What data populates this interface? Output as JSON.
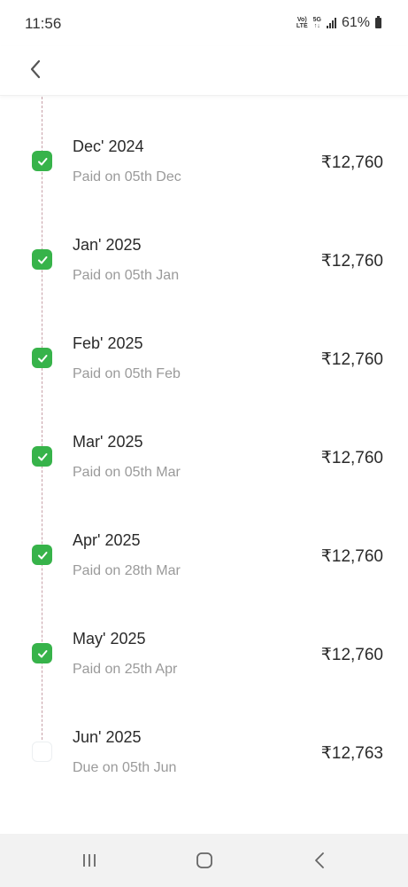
{
  "status": {
    "time": "11:56",
    "battery": "61%",
    "volte_top": "Vo)",
    "volte_bottom": "LTE",
    "net_top": "5G",
    "net_bottom": "↑↓"
  },
  "payments": [
    {
      "month": "Dec' 2024",
      "status_text": "Paid on 05th Dec",
      "amount": "₹12,760",
      "paid": true
    },
    {
      "month": "Jan' 2025",
      "status_text": "Paid on 05th Jan",
      "amount": "₹12,760",
      "paid": true
    },
    {
      "month": "Feb' 2025",
      "status_text": "Paid on 05th Feb",
      "amount": "₹12,760",
      "paid": true
    },
    {
      "month": "Mar' 2025",
      "status_text": "Paid on 05th Mar",
      "amount": "₹12,760",
      "paid": true
    },
    {
      "month": "Apr' 2025",
      "status_text": "Paid on 28th Mar",
      "amount": "₹12,760",
      "paid": true
    },
    {
      "month": "May' 2025",
      "status_text": "Paid on 25th Apr",
      "amount": "₹12,760",
      "paid": true
    },
    {
      "month": "Jun' 2025",
      "status_text": "Due on 05th Jun",
      "amount": "₹12,763",
      "paid": false
    }
  ],
  "colors": {
    "paid_green": "#37b34a",
    "timeline_line": "#c8a0a8"
  }
}
